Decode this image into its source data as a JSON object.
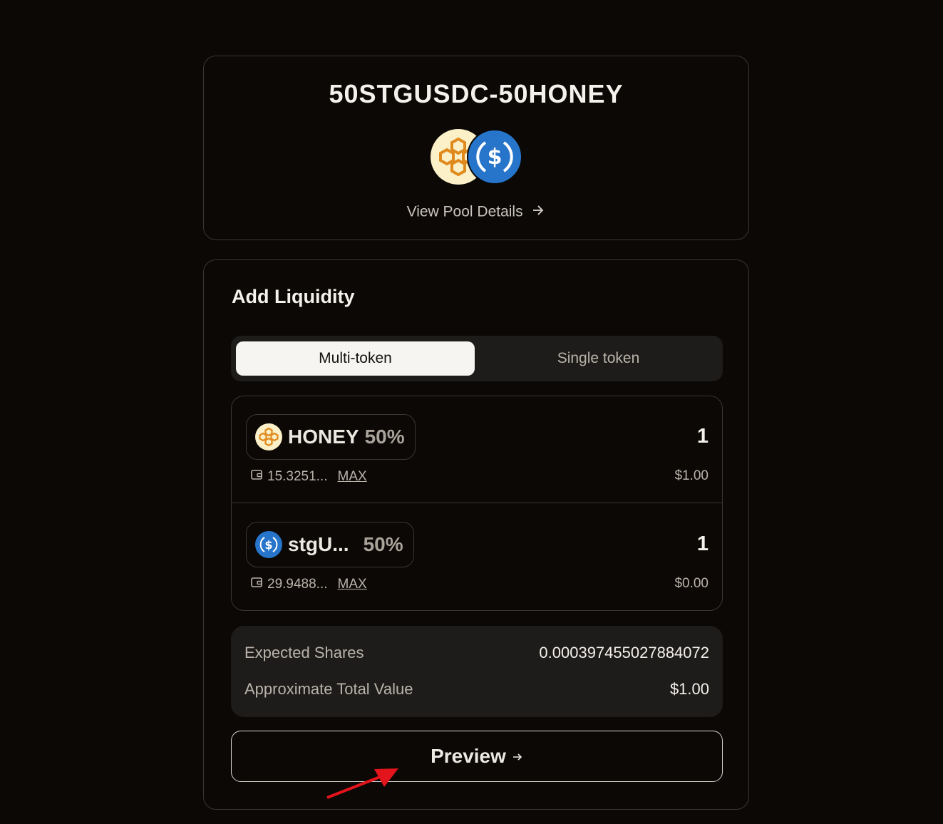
{
  "pool": {
    "title": "50STGUSDC-50HONEY",
    "view_details_label": "View Pool Details"
  },
  "add_liquidity": {
    "title": "Add Liquidity",
    "tabs": [
      {
        "label": "Multi-token",
        "active": true
      },
      {
        "label": "Single token",
        "active": false
      }
    ],
    "tokens": [
      {
        "symbol": "HONEY",
        "weight": "50%",
        "amount": "1",
        "balance": "15.3251...",
        "max_label": "MAX",
        "usd_value": "$1.00",
        "icon": "honey-icon"
      },
      {
        "symbol": "stgU...",
        "weight": "50%",
        "amount": "1",
        "balance": "29.9488...",
        "max_label": "MAX",
        "usd_value": "$0.00",
        "icon": "usdc-icon"
      }
    ],
    "summary": {
      "expected_shares_label": "Expected Shares",
      "expected_shares_value": "0.000397455027884072",
      "total_value_label": "Approximate Total Value",
      "total_value_value": "$1.00"
    },
    "preview_label": "Preview"
  },
  "colors": {
    "background": "#0b0806",
    "honey": "#e08a1e",
    "usdc": "#2775ca",
    "annotation": "#e3141b"
  }
}
